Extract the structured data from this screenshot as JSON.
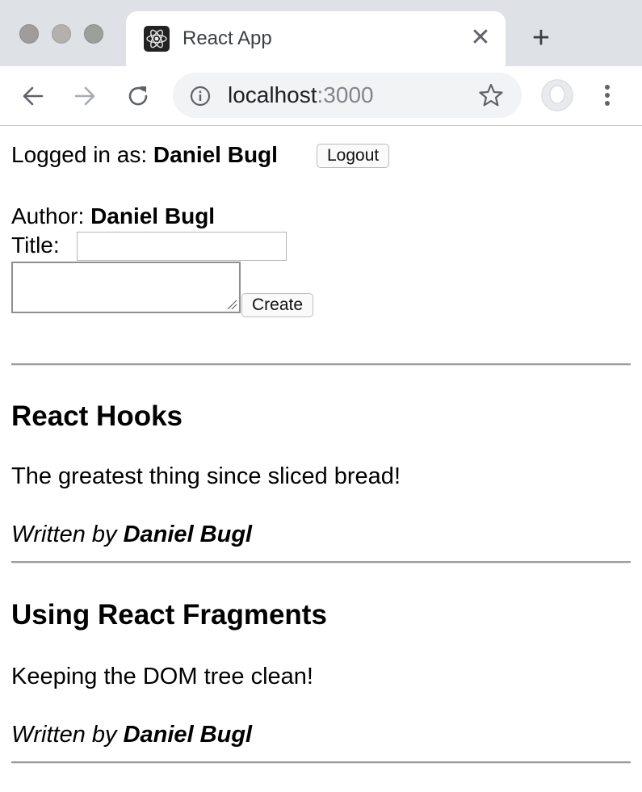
{
  "browser": {
    "tab_title": "React App",
    "tab_close_glyph": "✕",
    "new_tab_glyph": "+",
    "url_host": "localhost",
    "url_port": ":3000",
    "icons": [
      "react-favicon-icon",
      "back-arrow-icon",
      "forward-arrow-icon",
      "reload-icon",
      "info-icon",
      "star-icon",
      "profile-icon",
      "menu-dots-icon"
    ]
  },
  "session": {
    "logged_in_prefix": "Logged in as: ",
    "user": "Daniel Bugl",
    "logout_label": "Logout"
  },
  "create_form": {
    "author_prefix": "Author: ",
    "author": "Daniel Bugl",
    "title_label": "Title: ",
    "title_value": "",
    "content_value": "",
    "create_label": "Create"
  },
  "posts": [
    {
      "title": "React Hooks",
      "content": "The greatest thing since sliced bread!",
      "written_by_prefix": "Written by ",
      "author": "Daniel Bugl"
    },
    {
      "title": "Using React Fragments",
      "content": "Keeping the DOM tree clean!",
      "written_by_prefix": "Written by ",
      "author": "Daniel Bugl"
    }
  ]
}
